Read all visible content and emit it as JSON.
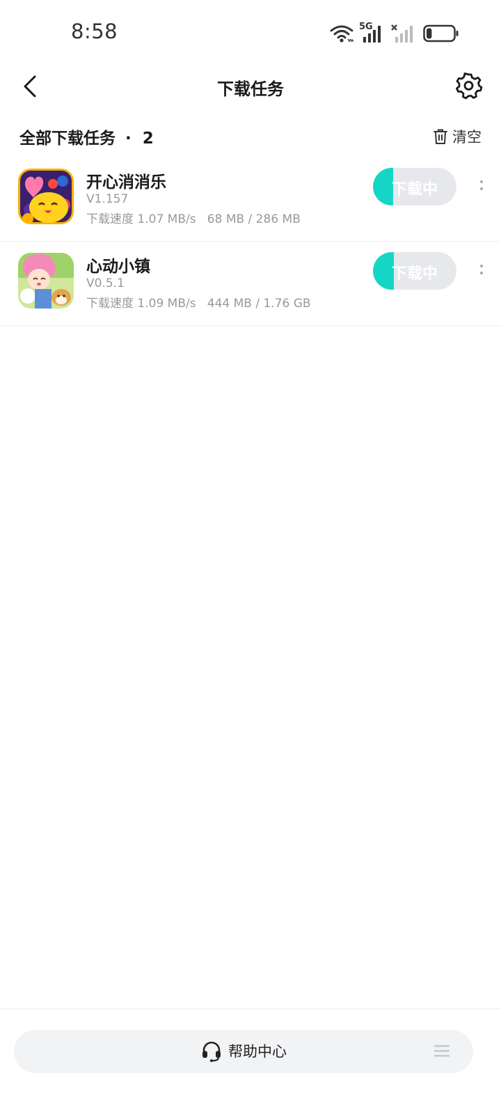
{
  "status_bar": {
    "time": "8:58",
    "network_label": "5G",
    "battery_level": 0.2,
    "icons": [
      "wifi-icon",
      "signal-5g-icon",
      "signal-no-service-icon",
      "battery-icon"
    ]
  },
  "nav": {
    "title": "下载任务",
    "icons": [
      "back-chevron-icon",
      "gear-icon"
    ]
  },
  "section": {
    "title": "全部下载任务",
    "separator": "·",
    "count": "2",
    "clear_label": "清空",
    "clear_icon": "trash-icon"
  },
  "tasks": [
    {
      "name": "开心消消乐",
      "version": "V1.157",
      "speed_text": "下载速度 1.07 MB/s   68 MB / 286 MB",
      "status_label": "下载中",
      "progress": 0.238,
      "icon": "happy-elimination-app-icon"
    },
    {
      "name": "心动小镇",
      "version": "V0.5.1",
      "speed_text": "下载速度 1.09 MB/s   444 MB / 1.76 GB",
      "status_label": "下载中",
      "progress": 0.246,
      "icon": "heart-town-app-icon"
    }
  ],
  "bottom": {
    "help_label": "帮助中心",
    "icons": [
      "headset-icon",
      "menu-icon"
    ]
  },
  "colors": {
    "accent": "#15d6c6",
    "button_bg": "#e6e8ec",
    "text_primary": "#1a1a1a",
    "text_secondary": "#999999"
  }
}
